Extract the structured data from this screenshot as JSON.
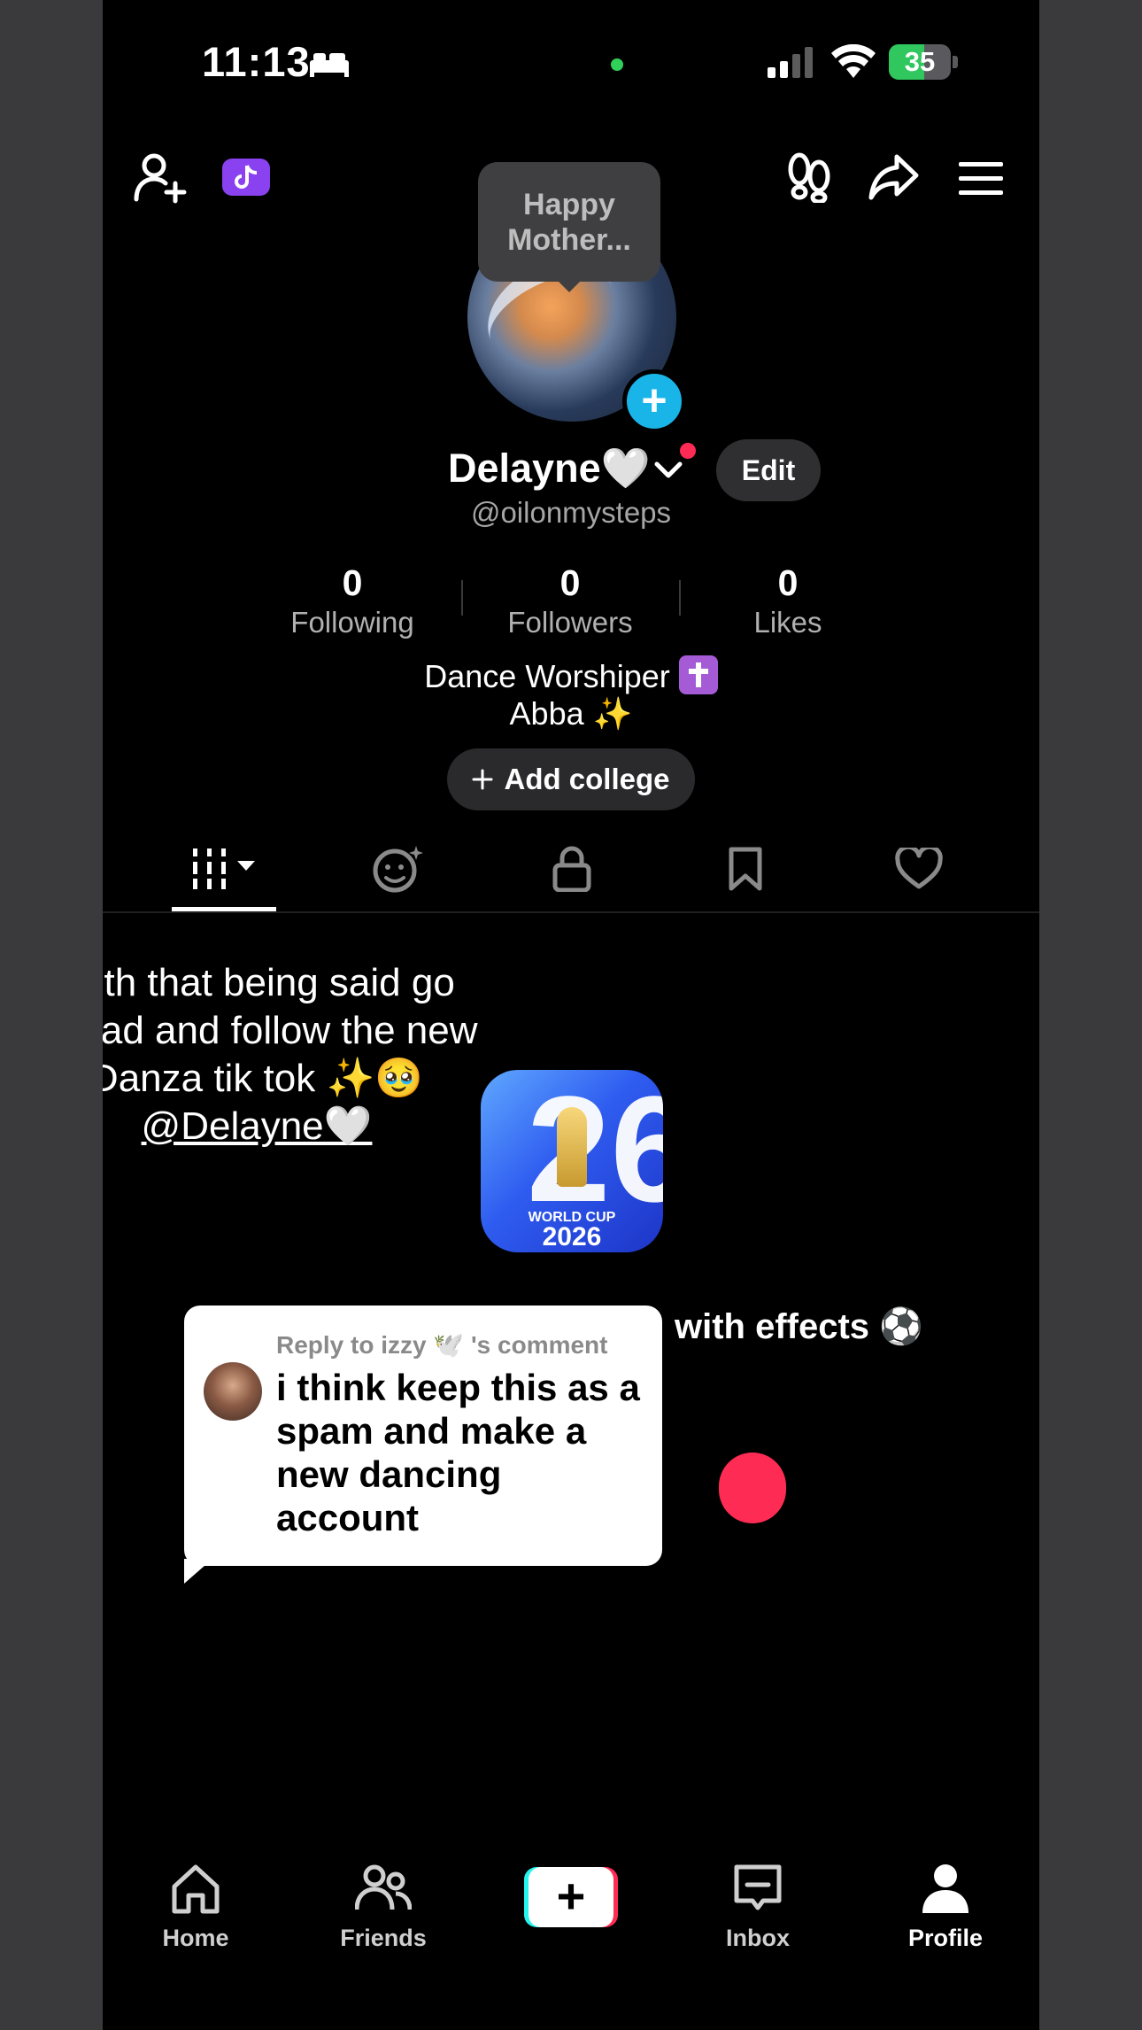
{
  "status_bar": {
    "time": "11:13",
    "battery": "35",
    "battery_level_percent": 35
  },
  "story_bubble": {
    "text": "Happy Mother..."
  },
  "profile": {
    "name": "Delayne🤍",
    "edit_label": "Edit",
    "handle": "@oilonmysteps"
  },
  "stats": [
    {
      "value": "0",
      "label": "Following"
    },
    {
      "value": "0",
      "label": "Followers"
    },
    {
      "value": "0",
      "label": "Likes"
    }
  ],
  "bio": {
    "line1": "Dance Worshiper",
    "line2": "Abba ✨"
  },
  "add_college_label": "Add college",
  "overlay": {
    "line1": "With that being said go",
    "line2": "ahead and follow the new",
    "line3": "Danza tik tok ✨🥹",
    "mention": "@Delayne🤍"
  },
  "world_cup_icon": {
    "label": "WORLD CUP",
    "year": "2026"
  },
  "effects_text": "with effects ⚽",
  "comment": {
    "meta": "Reply to izzy 🕊️ 's comment",
    "body": "i think keep this as a spam and make a new dancing account"
  },
  "bottom_nav": [
    {
      "label": "Home"
    },
    {
      "label": "Friends"
    },
    {
      "label": "Inbox"
    },
    {
      "label": "Profile"
    }
  ],
  "colors": {
    "accent_red": "#fe2c55",
    "accent_cyan": "#25f4ee",
    "plus_blue": "#19b5e8",
    "coin_purple": "#8a42f0"
  }
}
